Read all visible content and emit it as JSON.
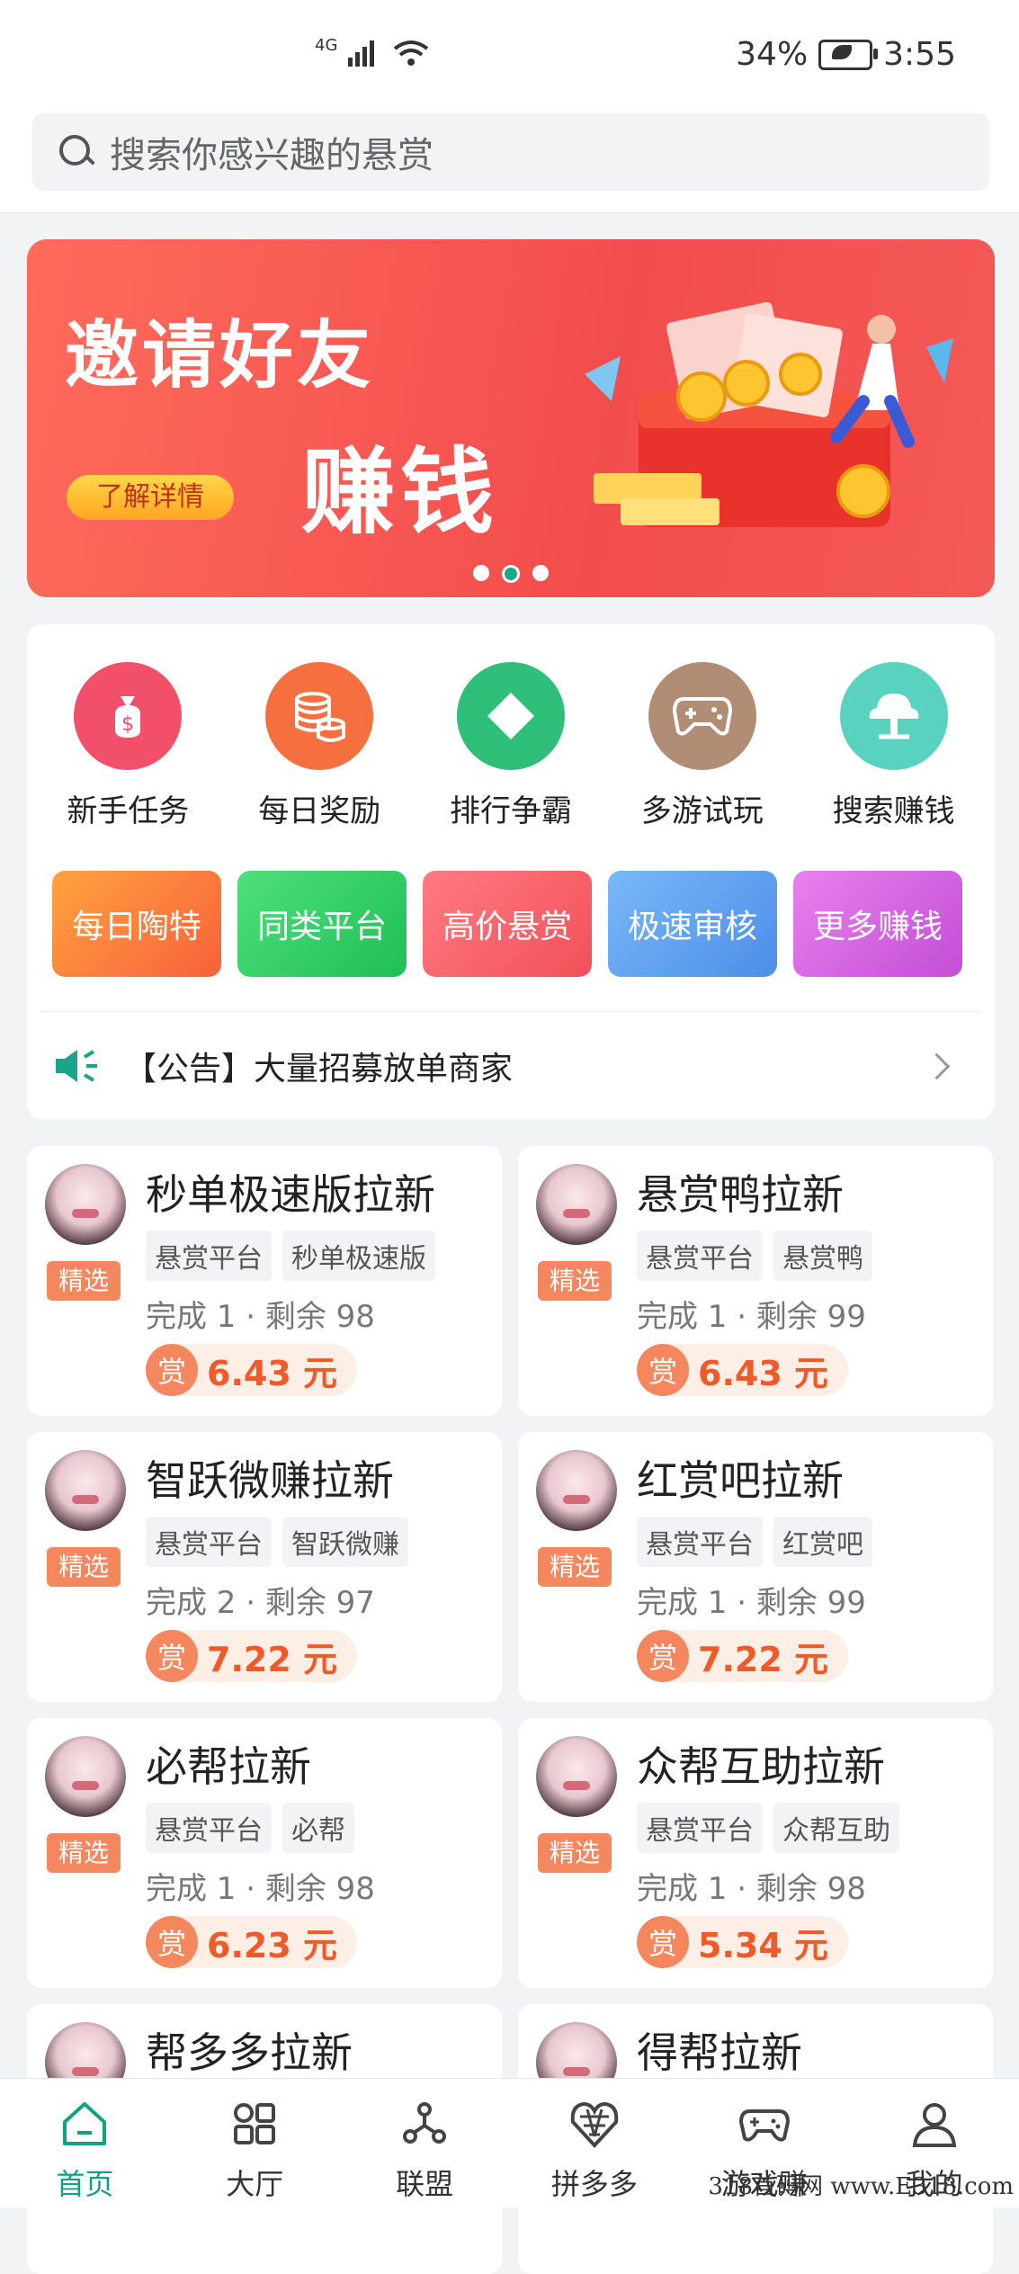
{
  "status_bar": {
    "network": "4G",
    "battery": "34%",
    "time": "3:55"
  },
  "search": {
    "placeholder": "搜索你感兴趣的悬赏"
  },
  "banner": {
    "title_line1": "邀请好友",
    "title_line2": "赚钱",
    "button_label": "了解详情",
    "page_count": 3,
    "active_page": 2
  },
  "quick_menu": {
    "icons": [
      {
        "label": "新手任务",
        "icon": "money-bag-icon",
        "color": "#f24f6a"
      },
      {
        "label": "每日奖励",
        "icon": "coins-icon",
        "color": "#f56f3f"
      },
      {
        "label": "排行争霸",
        "icon": "diamond-icon",
        "color": "#2fbf78"
      },
      {
        "label": "多游试玩",
        "icon": "gamepad-icon",
        "color": "#b08d74"
      },
      {
        "label": "搜索赚钱",
        "icon": "tree-icon",
        "color": "#59d3c0"
      }
    ],
    "buttons": [
      {
        "label": "每日陶特",
        "color_from": "#ffa33e",
        "color_to": "#f8603c"
      },
      {
        "label": "同类平台",
        "color_from": "#4fe07c",
        "color_to": "#1fbe55"
      },
      {
        "label": "高价悬赏",
        "color_from": "#ff7b82",
        "color_to": "#f25058"
      },
      {
        "label": "极速审核",
        "color_from": "#7ab8f7",
        "color_to": "#4c8ee9"
      },
      {
        "label": "更多赚钱",
        "color_from": "#ea80ee",
        "color_to": "#c24ed6"
      }
    ]
  },
  "notice": {
    "text": "【公告】大量招募放单商家"
  },
  "tasks": [
    {
      "title": "秒单极速版拉新",
      "badge": "精选",
      "tags": [
        "悬赏平台",
        "秒单极速版"
      ],
      "stats": "完成 1 · 剩余 98",
      "price_icon": "赏",
      "price": "6.43 元"
    },
    {
      "title": "悬赏鸭拉新",
      "badge": "精选",
      "tags": [
        "悬赏平台",
        "悬赏鸭"
      ],
      "stats": "完成 1 · 剩余 99",
      "price_icon": "赏",
      "price": "6.43 元"
    },
    {
      "title": "智跃微赚拉新",
      "badge": "精选",
      "tags": [
        "悬赏平台",
        "智跃微赚"
      ],
      "stats": "完成 2 · 剩余 97",
      "price_icon": "赏",
      "price": "7.22 元"
    },
    {
      "title": "红赏吧拉新",
      "badge": "精选",
      "tags": [
        "悬赏平台",
        "红赏吧"
      ],
      "stats": "完成 1 · 剩余 99",
      "price_icon": "赏",
      "price": "7.22 元"
    },
    {
      "title": "必帮拉新",
      "badge": "精选",
      "tags": [
        "悬赏平台",
        "必帮"
      ],
      "stats": "完成 1 · 剩余 98",
      "price_icon": "赏",
      "price": "6.23 元"
    },
    {
      "title": "众帮互助拉新",
      "badge": "精选",
      "tags": [
        "悬赏平台",
        "众帮互助"
      ],
      "stats": "完成 1 · 剩余 98",
      "price_icon": "赏",
      "price": "5.34 元"
    },
    {
      "title": "帮多多拉新"
    },
    {
      "title": "得帮拉新"
    }
  ],
  "tabbar": {
    "active_color": "#12a086",
    "items": [
      {
        "label": "首页",
        "icon": "home-icon"
      },
      {
        "label": "大厅",
        "icon": "grid-icon"
      },
      {
        "label": "联盟",
        "icon": "network-icon"
      },
      {
        "label": "拼多多",
        "icon": "pinduoduo-icon"
      },
      {
        "label": "游戏赚",
        "icon": "gamepad-icon"
      },
      {
        "label": "我的",
        "icon": "user-icon"
      }
    ]
  },
  "watermark": "318首码网 www.E318.com"
}
